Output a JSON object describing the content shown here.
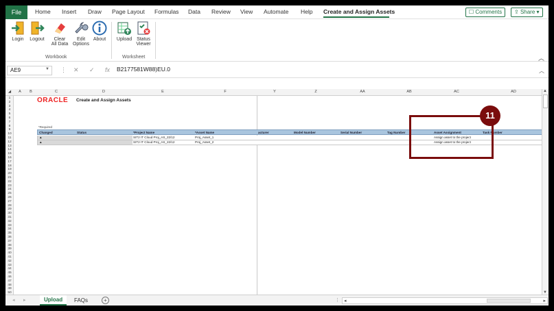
{
  "ribbon_tabs": {
    "file": "File",
    "items": [
      "Home",
      "Insert",
      "Draw",
      "Page Layout",
      "Formulas",
      "Data",
      "Review",
      "View",
      "Automate",
      "Help"
    ],
    "active": "Create and Assign Assets",
    "comments": "Comments",
    "share": "Share"
  },
  "ribbon": {
    "login": "Login",
    "logout": "Logout",
    "clear": "Clear",
    "clear_sub": "All Data",
    "edit": "Edit",
    "edit_sub": "Options",
    "about": "About",
    "upload": "Upload",
    "status": "Status",
    "status_sub": "Viewer",
    "group_workbook": "Workbook",
    "group_worksheet": "Worksheet"
  },
  "formula_bar": {
    "name_box": "AE9",
    "fx": "fx",
    "formula": "B2177581W88)EU.0"
  },
  "columns": [
    "A",
    "B",
    "C",
    "D",
    "E",
    "F",
    "Y",
    "Z",
    "AA",
    "AB",
    "AC",
    "AD"
  ],
  "sheet": {
    "brand": "ORACLE",
    "title": "Create and Assign Assets",
    "required_note": "*Required",
    "headers": [
      "Changed",
      "Status",
      "*Project Name",
      "*Asset Name",
      "acturer",
      "Model Number",
      "Serial Number",
      "Tag Number",
      "Asset Assignment",
      "Task Number"
    ],
    "rows": [
      {
        "changed": "▲",
        "status": "",
        "project": "SIT2 IT Cloud Proj_AS_22/12",
        "asset": "Proj_Asset_1",
        "assignment": "Assign asset to the project"
      },
      {
        "changed": "▲",
        "status": "",
        "project": "SIT2 IT Cloud Proj_AS_22/12",
        "asset": "Proj_Asset_2",
        "assignment": "Assign asset to the project"
      }
    ]
  },
  "callout": {
    "number": "11"
  },
  "sheet_tabs": {
    "active": "Upload",
    "other": "FAQs",
    "add": "+"
  }
}
